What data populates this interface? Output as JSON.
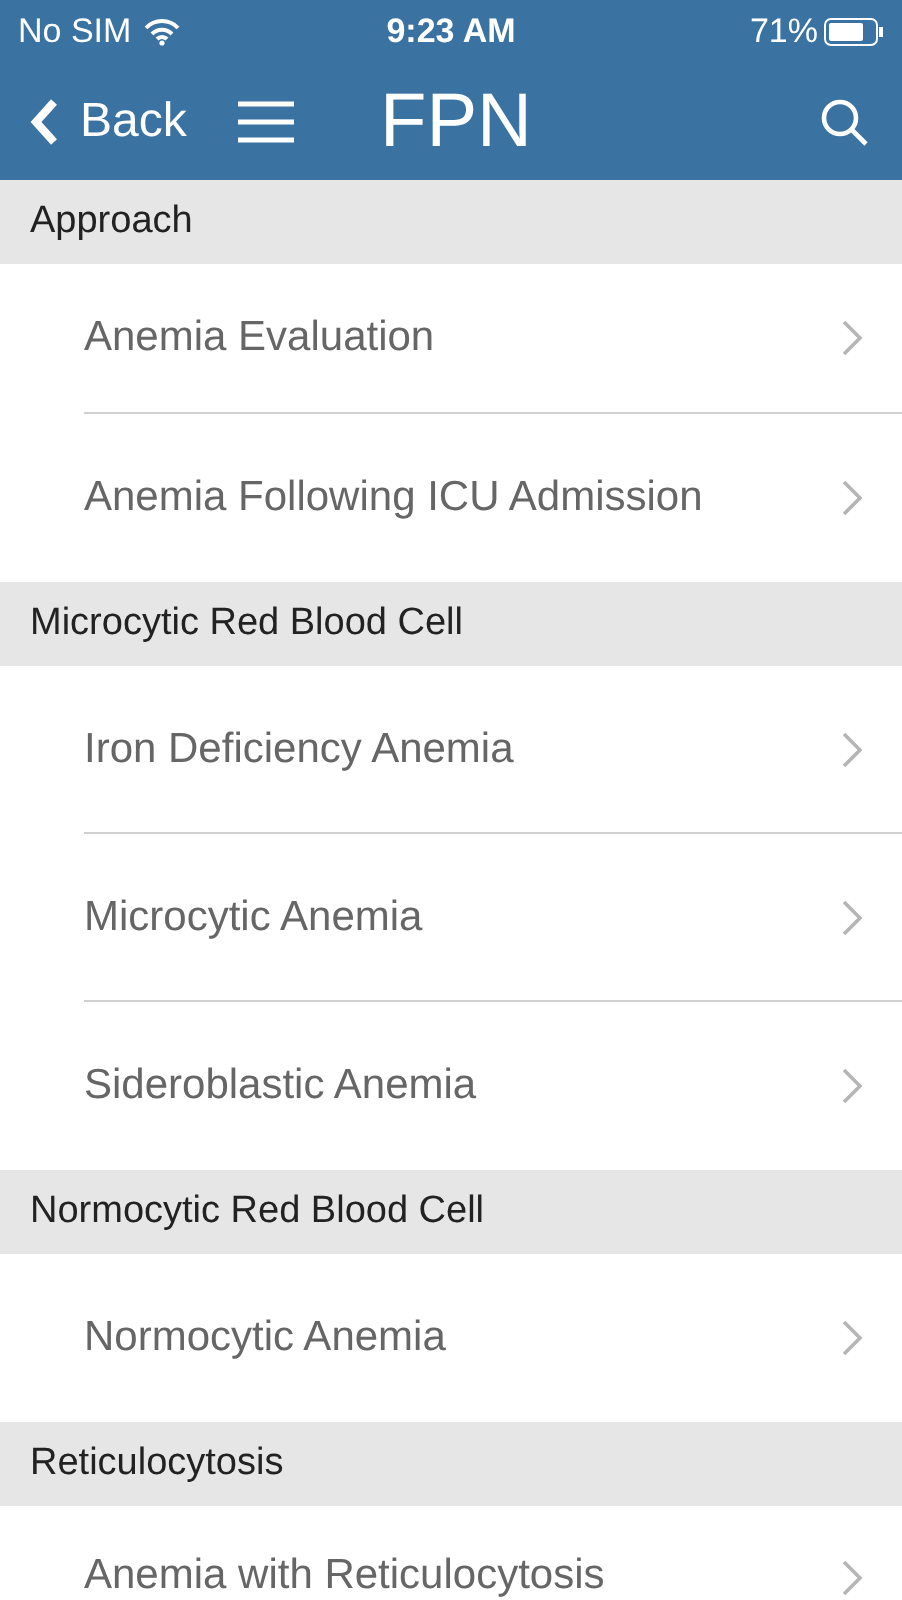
{
  "status_bar": {
    "carrier": "No SIM",
    "time": "9:23 AM",
    "battery": "71%"
  },
  "nav_bar": {
    "back": "Back",
    "title": "FPN"
  },
  "sections": [
    {
      "title": "Approach",
      "items": [
        "Anemia Evaluation",
        "Anemia Following ICU Admission"
      ]
    },
    {
      "title": "Microcytic Red Blood Cell",
      "items": [
        "Iron Deficiency Anemia",
        "Microcytic Anemia",
        "Sideroblastic Anemia"
      ]
    },
    {
      "title": "Normocytic Red Blood Cell",
      "items": [
        "Normocytic Anemia"
      ]
    },
    {
      "title": "Reticulocytosis",
      "items": [
        "Anemia with Reticulocytosis"
      ]
    }
  ]
}
